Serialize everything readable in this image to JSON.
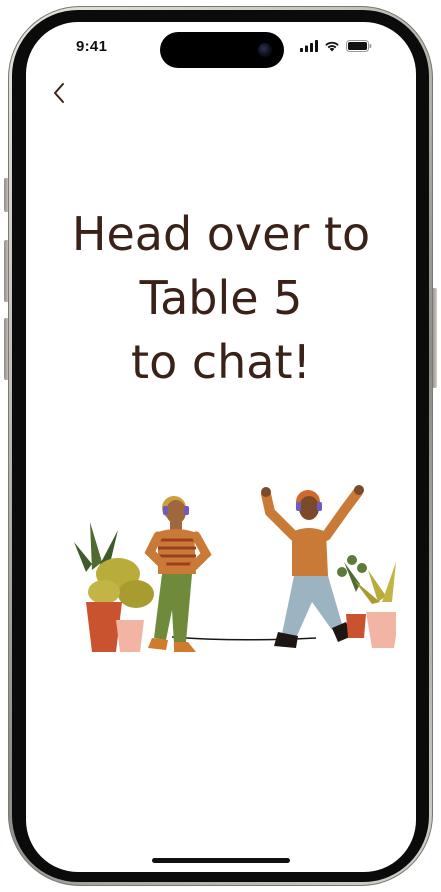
{
  "status_bar": {
    "time": "9:41",
    "icons": [
      "cellular-signal-icon",
      "wifi-icon",
      "battery-icon"
    ]
  },
  "nav": {
    "back_icon": "chevron-left-icon"
  },
  "headline": {
    "line1": "Head over to",
    "line2": "Table 5",
    "line3": "to chat!"
  },
  "illustration": {
    "subject": "two-people-with-headphones-dancing-among-potted-plants"
  },
  "colors": {
    "headline_text": "#3a2218",
    "background": "#ffffff",
    "shirt_orange": "#c97a36",
    "pants_olive": "#6e8a3a",
    "pants_blue": "#9cb3c1",
    "pot_red": "#c9532f",
    "pot_pink": "#f2b5a4"
  }
}
